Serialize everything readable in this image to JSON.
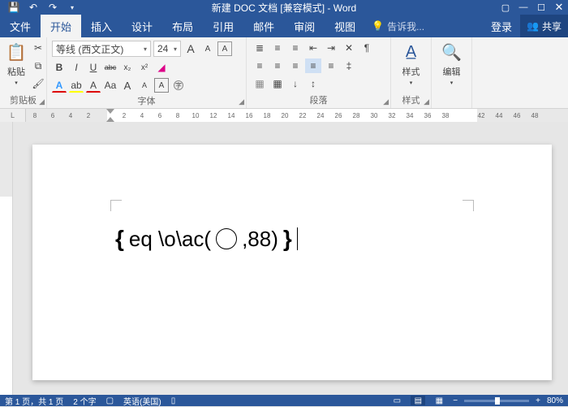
{
  "app": {
    "title": "新建 DOC 文档 [兼容模式] - Word"
  },
  "tabs": {
    "file": "文件",
    "home": "开始",
    "insert": "插入",
    "design": "设计",
    "layout": "布局",
    "references": "引用",
    "mailings": "邮件",
    "review": "审阅",
    "view": "视图",
    "tell_me": "告诉我...",
    "signin": "登录",
    "share": "共享"
  },
  "ribbon": {
    "clipboard": {
      "label": "剪贴板",
      "paste": "粘贴"
    },
    "font": {
      "label": "字体",
      "name": "等线 (西文正文)",
      "size": "24",
      "bold": "B",
      "italic": "I",
      "underline": "U",
      "strike": "abc",
      "sub": "x₂",
      "sup": "x²",
      "grow": "A",
      "shrink": "A",
      "caseAa": "Aa",
      "clear": "A"
    },
    "paragraph": {
      "label": "段落"
    },
    "styles": {
      "label": "样式",
      "btn": "样式"
    },
    "editing": {
      "label": "编辑",
      "btn": "编辑"
    }
  },
  "ruler": {
    "ticks": [
      "8",
      "6",
      "4",
      "2",
      "",
      "2",
      "4",
      "6",
      "8",
      "10",
      "12",
      "14",
      "16",
      "18",
      "20",
      "22",
      "24",
      "26",
      "28",
      "30",
      "32",
      "34",
      "36",
      "38",
      "",
      "42",
      "44",
      "46",
      "48"
    ]
  },
  "document": {
    "field_open": "{",
    "field_text_pre": " eq \\o\\ac(",
    "field_circle": "○",
    "field_text_post": ",88)",
    "field_close": "}"
  },
  "status": {
    "page": "第 1 页，共 1 页",
    "words": "2 个字",
    "lang": "英语(美国)",
    "zoom": "80%"
  }
}
